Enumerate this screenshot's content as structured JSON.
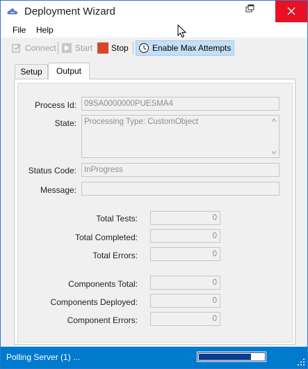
{
  "window": {
    "title": "Deployment Wizard"
  },
  "menu": {
    "file": "File",
    "help": "Help"
  },
  "toolbar": {
    "connect": "Connect",
    "start": "Start",
    "stop": "Stop",
    "max_attempts": "Enable Max Attempts"
  },
  "tabs": {
    "setup": "Setup",
    "output": "Output"
  },
  "form": {
    "process_id_label": "Process Id:",
    "process_id_value": "09SA0000000PUESMA4",
    "state_label": "State:",
    "state_value": "Processing Type: CustomObject",
    "status_code_label": "Status Code:",
    "status_code_value": "InProgress",
    "message_label": "Message:",
    "message_value": "",
    "total_tests_label": "Total Tests:",
    "total_tests_value": "0",
    "total_completed_label": "Total Completed:",
    "total_completed_value": "0",
    "total_errors_label": "Total Errors:",
    "total_errors_value": "0",
    "components_total_label": "Components Total:",
    "components_total_value": "0",
    "components_deployed_label": "Components Deployed:",
    "components_deployed_value": "0",
    "component_errors_label": "Component Errors:",
    "component_errors_value": "0"
  },
  "status": {
    "text": "Polling Server (1) ...",
    "progress_fraction": 0.8
  },
  "colors": {
    "accent": "#007acc",
    "close": "#e81123",
    "stop": "#d9452b",
    "progress": "#0a3c8c"
  }
}
